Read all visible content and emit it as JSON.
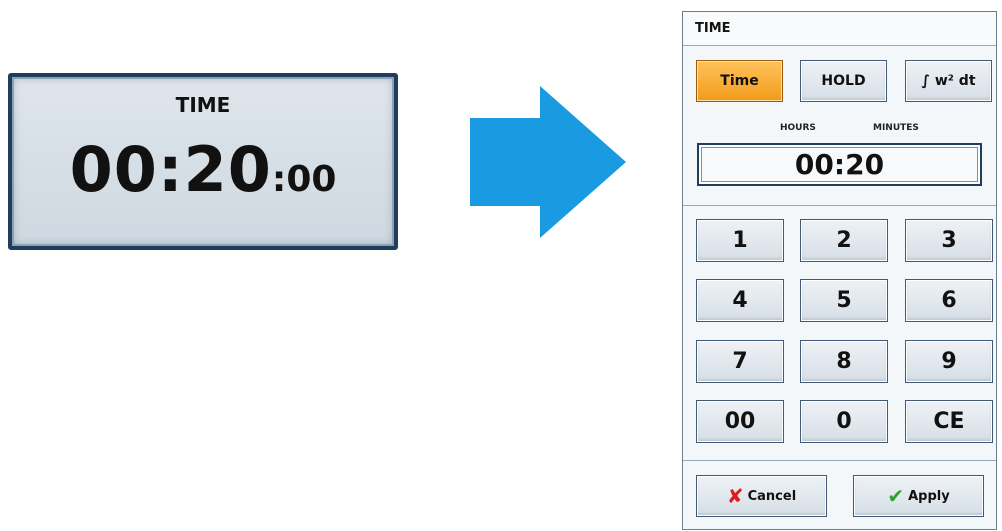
{
  "tile": {
    "title": "TIME",
    "value_hm": "00:20",
    "value_sec": ":00"
  },
  "dialog": {
    "title": "TIME",
    "modes": [
      {
        "label": "Time",
        "active": true
      },
      {
        "label": "HOLD",
        "active": false
      },
      {
        "label": "∫ w² dt",
        "active": false
      }
    ],
    "hours_label": "HOURS",
    "minutes_label": "MINUTES",
    "display_value": "00:20",
    "keys": [
      "1",
      "2",
      "3",
      "4",
      "5",
      "6",
      "7",
      "8",
      "9",
      "00",
      "0",
      "CE"
    ],
    "cancel_label": "Cancel",
    "apply_label": "Apply"
  },
  "colors": {
    "arrow": "#1a9ae0",
    "active_button": "#f7a82b",
    "border_dark": "#1f3d5c"
  },
  "icons": {
    "cancel": "x-icon",
    "apply": "check-icon",
    "arrow": "arrow-right-icon"
  }
}
